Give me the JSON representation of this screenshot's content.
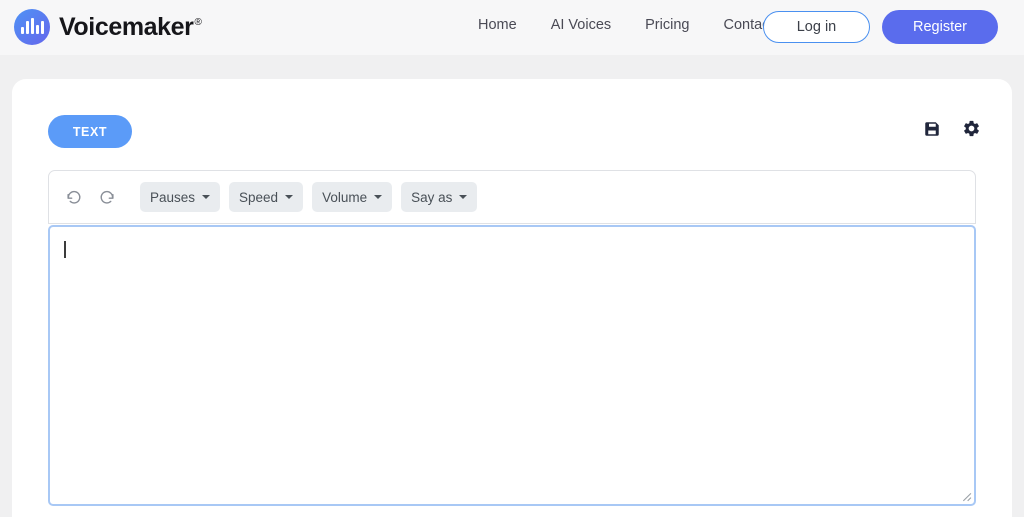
{
  "header": {
    "brand": {
      "name": "Voicemaker",
      "registered_mark": "®",
      "logo_icon": "waveform-logo-icon"
    },
    "nav": [
      {
        "label": "Home"
      },
      {
        "label": "AI Voices"
      },
      {
        "label": "Pricing"
      },
      {
        "label": "Contact"
      }
    ],
    "login_label": "Log in",
    "register_label": "Register"
  },
  "main": {
    "tab_label": "TEXT",
    "icons": [
      {
        "name": "save-icon"
      },
      {
        "name": "settings-gear-icon"
      }
    ],
    "toolbar": {
      "undo_icon": "undo-icon",
      "redo_icon": "redo-icon",
      "dropdowns": [
        {
          "label": "Pauses"
        },
        {
          "label": "Speed"
        },
        {
          "label": "Volume"
        },
        {
          "label": "Say as"
        }
      ]
    },
    "editor": {
      "value": "",
      "placeholder": ""
    }
  },
  "colors": {
    "page_bg": "#f0f0f1",
    "header_bg": "#f7f7f8",
    "accent_register": "#5a6ced",
    "accent_login_border": "#4a90f0",
    "accent_tab": "#5b9bf8",
    "focus_border": "#a8c8f5",
    "dropdown_bg": "#e9ecef"
  }
}
